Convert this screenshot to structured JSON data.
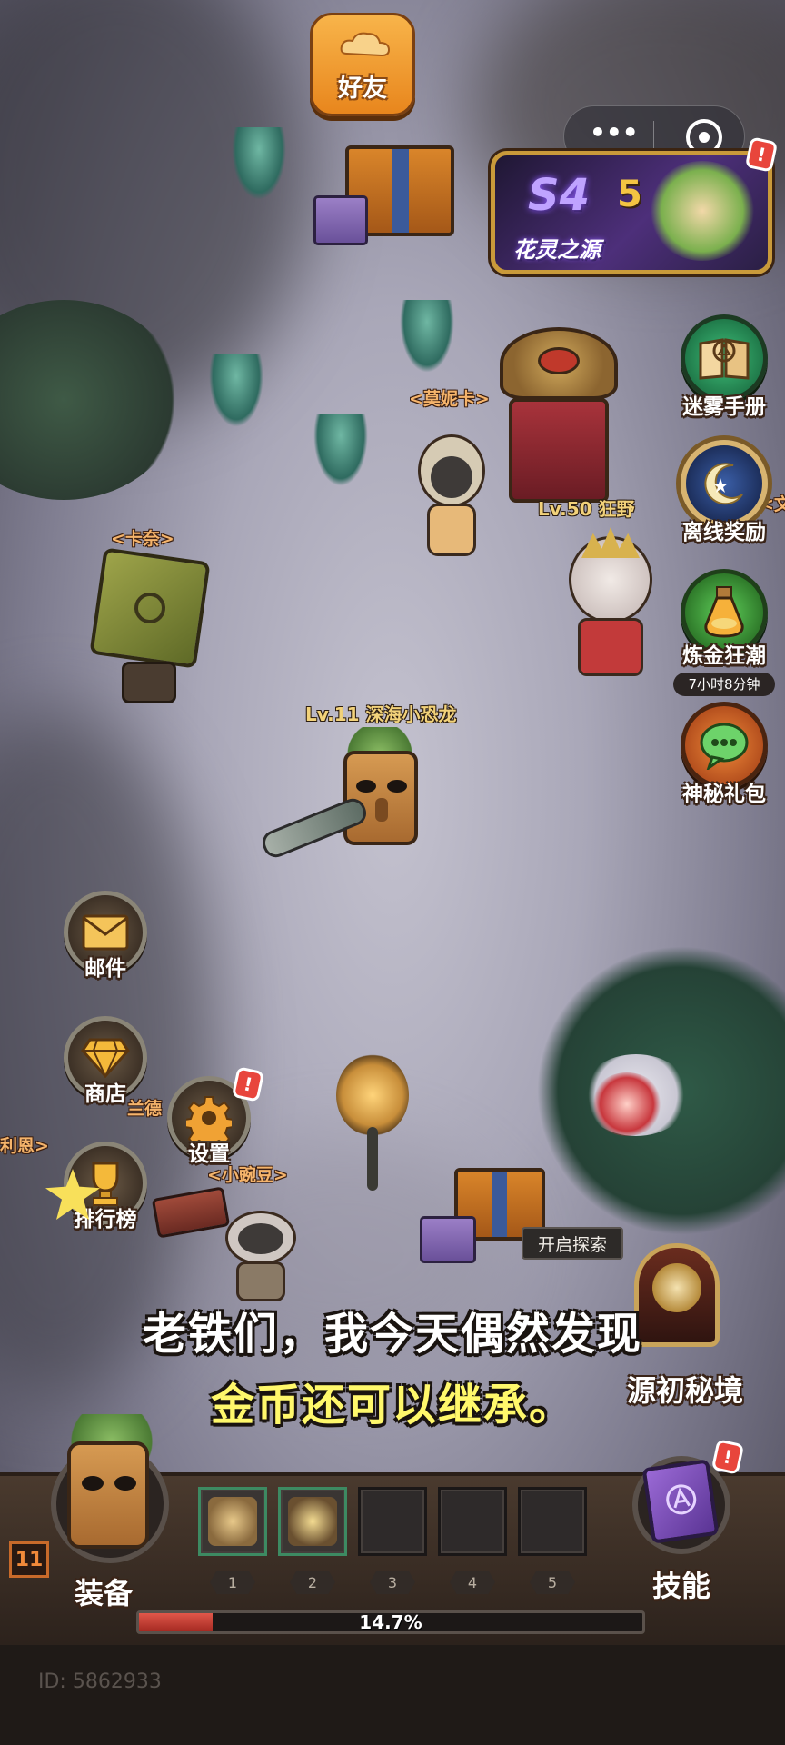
{
  "top": {
    "friends_label": "好友",
    "menu_dots": "•••",
    "season_banner": {
      "season": "S4",
      "title": "花灵之源",
      "alert": "!"
    }
  },
  "right_menu": [
    {
      "label": "迷雾手册",
      "icon": "book-icon"
    },
    {
      "label": "离线奖励",
      "icon": "moon-icon"
    },
    {
      "label": "炼金狂潮",
      "icon": "potion-icon",
      "timer": "7小时8分钟"
    },
    {
      "label": "神秘礼包",
      "icon": "chat-bubble-icon"
    }
  ],
  "left_menu": [
    {
      "label": "邮件",
      "icon": "envelope-icon"
    },
    {
      "label": "商店",
      "icon": "gem-icon"
    },
    {
      "label": "设置",
      "icon": "gear-icon",
      "alert": "!"
    },
    {
      "label": "排行榜",
      "icon": "trophy-icon"
    }
  ],
  "npcs": {
    "momika": "<莫妮卡>",
    "kana": "<卡奈>",
    "wen_partial": "<文",
    "xiaowandou": "<小豌豆>",
    "lieen_partial": "利恩>",
    "lanxx_partial": "兰德"
  },
  "players": {
    "other": "Lv.50 狂野",
    "self": "Lv.11 深海小恐龙"
  },
  "explore_label": "开启探索",
  "dungeon": {
    "label": "源初秘境"
  },
  "subtitle": {
    "line1": "老铁们，我今天偶然发现",
    "line2": "金币还可以继承。"
  },
  "bottom": {
    "level": "11",
    "equip_label": "装备",
    "skill_label": "技能",
    "skill_alert": "!",
    "slot_numbers": [
      "1",
      "2",
      "3",
      "4",
      "5"
    ],
    "progress_text": "14.7%",
    "progress_value": 0.147,
    "id_text": "ID: 5862933"
  },
  "colors": {
    "accent_orange": "#f39a2b",
    "alert_red": "#e8453c",
    "subtitle_text": "#fff86b",
    "progress_red": "#c8372f"
  }
}
